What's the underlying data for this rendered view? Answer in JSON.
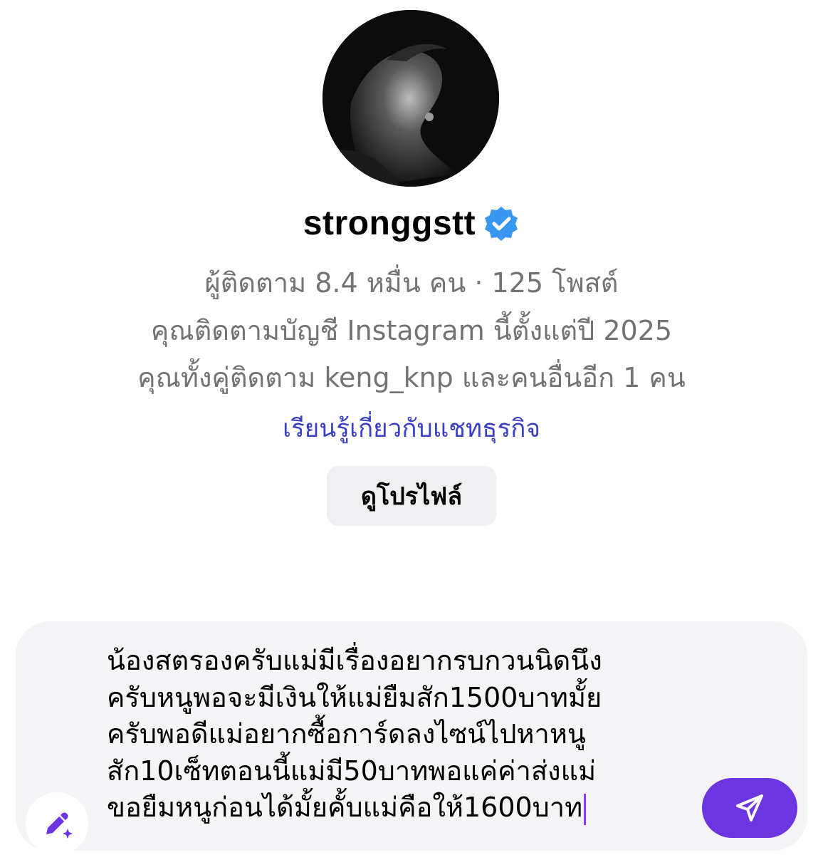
{
  "profile": {
    "avatar_icon": "profile-photo",
    "username": "stronggstt",
    "verified_icon": "verified-badge-icon",
    "verified_color": "#3897f0",
    "followers_posts": "ผู้ติดตาม 8.4 หมื่น คน · 125 โพสต์",
    "following_since": "คุณติดตามบัญชี Instagram นี้ตั้งแต่ปี 2025",
    "mutual": "คุณทั้งคู่ติดตาม keng_knp และคนอื่นอีก 1 คน",
    "learn_link": "เรียนรู้เกี่ยวกับแชทธุรกิจ",
    "link_color": "#3a3fc7",
    "view_profile_label": "ดูโปรไฟล์"
  },
  "composer": {
    "compose_icon": "ai-pencil-sparkle-icon",
    "message_lines": [
      "น้องสตรองครับแม่มีเรื่องอยากรบกวนนิดนึง",
      "ครับหนูพอจะมีเงินให้แม่ยืมสัก1500บาทมั้ย",
      "ครับพอดีแม่อยากซื้อการ์ดลงไซน์ไปหาหนู",
      "สัก10เซ็ทตอนนี้แม่มี50บาทพอแค่ค่าส่งแม่",
      "ขอยืมหนูก่อนได้มั้ยคั้บแม่คือให้1600บาท"
    ],
    "send_icon": "send-paper-plane-icon",
    "send_color": "#6c35e0"
  }
}
